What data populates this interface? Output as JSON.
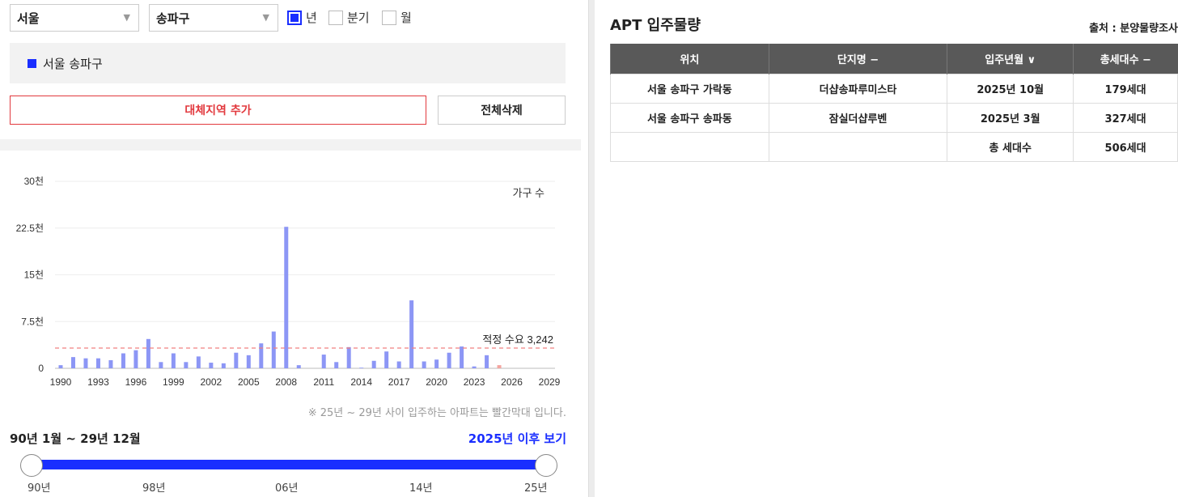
{
  "filters": {
    "city": "서울",
    "district": "송파구",
    "period_options": [
      {
        "label": "년",
        "checked": true
      },
      {
        "label": "분기",
        "checked": false
      },
      {
        "label": "월",
        "checked": false
      }
    ]
  },
  "selected_region": "서울 송파구",
  "buttons": {
    "add_region": "대체지역 추가",
    "delete_all": "전체삭제"
  },
  "chart_data": {
    "type": "bar",
    "y_ticks": [
      "0",
      "7.5천",
      "15천",
      "22.5천",
      "30천"
    ],
    "ylim": [
      0,
      30000
    ],
    "x_ticks": [
      "1990",
      "1993",
      "1996",
      "1999",
      "2002",
      "2005",
      "2008",
      "2011",
      "2014",
      "2017",
      "2020",
      "2023",
      "2026",
      "2029"
    ],
    "years": [
      1990,
      1991,
      1992,
      1993,
      1994,
      1995,
      1996,
      1997,
      1998,
      1999,
      2000,
      2001,
      2002,
      2003,
      2004,
      2005,
      2006,
      2007,
      2008,
      2009,
      2010,
      2011,
      2012,
      2013,
      2014,
      2015,
      2016,
      2017,
      2018,
      2019,
      2020,
      2021,
      2022,
      2023,
      2024,
      2025
    ],
    "values": [
      500,
      1800,
      1600,
      1600,
      1300,
      2400,
      2900,
      4700,
      1000,
      2400,
      1000,
      1900,
      900,
      800,
      2500,
      2100,
      4000,
      5900,
      22700,
      500,
      0,
      2200,
      1000,
      3400,
      100,
      1200,
      2700,
      1100,
      10900,
      1100,
      1400,
      2500,
      3500,
      300,
      2100,
      506
    ],
    "bar_color": "#8c96f5",
    "future_color": "#f4a5a0",
    "series_label": "가구 수",
    "reference_line": {
      "label": "적정 수요 3,242",
      "value": 3242,
      "color": "#f08080"
    }
  },
  "chart_note": "※ 25년 ~ 29년 사이 입주하는 아파트는 빨간막대 입니다.",
  "range": {
    "label": "90년 1월 ~ 29년 12월",
    "link": "2025년 이후 보기",
    "ticks": [
      "90년",
      "98년",
      "06년",
      "14년",
      "25년"
    ]
  },
  "right": {
    "title": "APT 입주물량",
    "source": "출처 : 분양물량조사",
    "columns": [
      "위치",
      "단지명 −",
      "입주년월 ∨",
      "총세대수 −"
    ],
    "rows": [
      [
        "서울 송파구 가락동",
        "더샵송파루미스타",
        "2025년 10월",
        "179세대"
      ],
      [
        "서울 송파구 송파동",
        "잠실더샵루벤",
        "2025년 3월",
        "327세대"
      ],
      [
        "",
        "",
        "총 세대수",
        "506세대"
      ]
    ]
  }
}
